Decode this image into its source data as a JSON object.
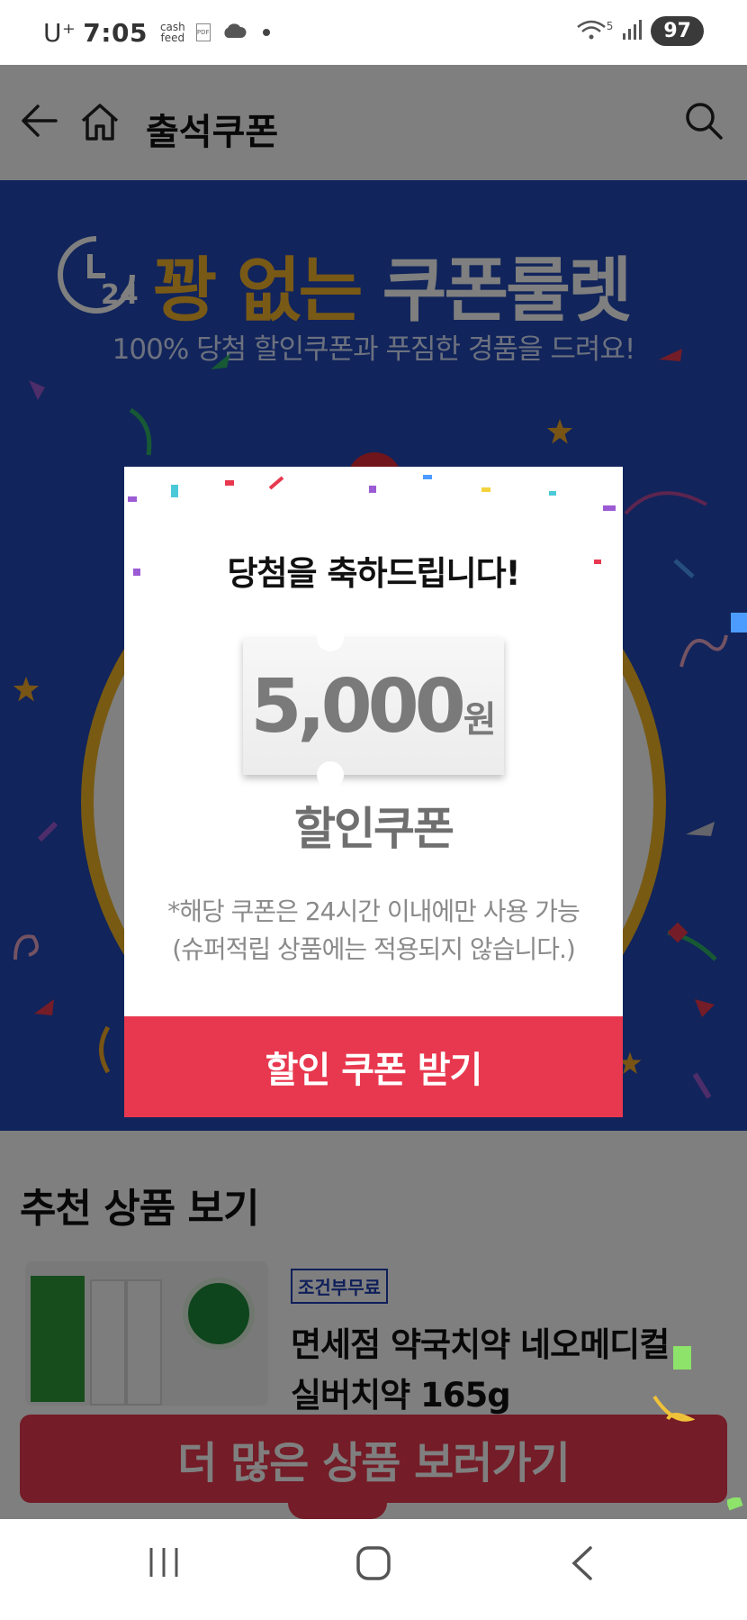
{
  "status_bar": {
    "carrier": "U⁺",
    "time": "7:05",
    "app_badge_line1": "cash",
    "app_badge_line2": "feed",
    "pdf_label": "PDF",
    "network_label": "5",
    "battery": "97"
  },
  "header": {
    "title": "출석쿠폰"
  },
  "banner": {
    "timer_label": "24",
    "title_part1": "꽝 없는",
    "title_part2": "쿠폰룰렛",
    "subtitle": "100% 당첨 할인쿠폰과 푸짐한 경품을 드려요!"
  },
  "modal": {
    "title": "당첨을 축하드립니다!",
    "coupon_amount": "5,000",
    "coupon_unit": "원",
    "coupon_label": "할인쿠폰",
    "note_line1": "*해당 쿠폰은 24시간 이내에만 사용 가능",
    "note_line2": "(슈퍼적립 상품에는 적용되지 않습니다.)",
    "receive_button": "할인 쿠폰 받기"
  },
  "recommend": {
    "section_title": "추천 상품 보기",
    "product": {
      "badge": "조건부무료",
      "name_line1": "면세점 약국치약 네오메디컬",
      "name_line2": "실버치약 165g"
    },
    "more_button": "더 많은 상품 보러가기"
  },
  "colors": {
    "banner_blue": "#2349b7",
    "accent_yellow": "#f3b22c",
    "accent_red": "#e8384f",
    "badge_blue": "#1f3fb5"
  }
}
